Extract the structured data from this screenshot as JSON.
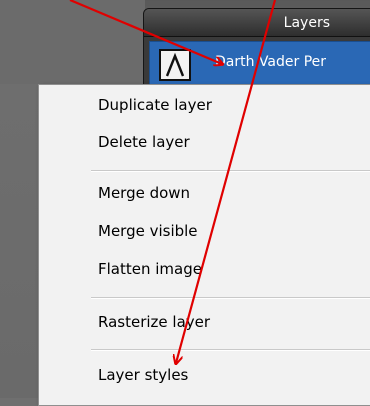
{
  "panel": {
    "title": "Layers",
    "layer_name": "Darth Vader Per",
    "thumbnail_icon": "text-layer-icon"
  },
  "menu": {
    "items": [
      "Duplicate layer",
      "Delete layer",
      "Merge down",
      "Merge visible",
      "Flatten image",
      "Rasterize layer",
      "Layer styles"
    ]
  },
  "annotations": {
    "arrow_color": "#e00000",
    "arrows": [
      "arrow-to-layer-row",
      "arrow-to-layer-styles"
    ]
  }
}
